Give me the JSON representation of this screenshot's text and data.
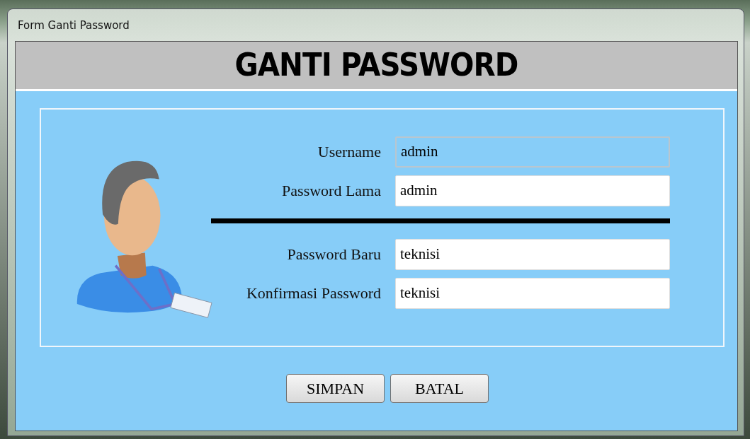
{
  "window": {
    "title": "Form Ganti Password"
  },
  "header": {
    "title": "GANTI PASSWORD"
  },
  "fields": [
    {
      "label": "Username",
      "value": "admin",
      "disabled": true
    },
    {
      "label": "Password Lama",
      "value": "admin",
      "disabled": false
    },
    {
      "label": "Password Baru",
      "value": "teknisi",
      "disabled": false
    },
    {
      "label": "Konfirmasi Password",
      "value": "teknisi",
      "disabled": false
    }
  ],
  "buttons": [
    "SIMPAN",
    "BATAL"
  ]
}
